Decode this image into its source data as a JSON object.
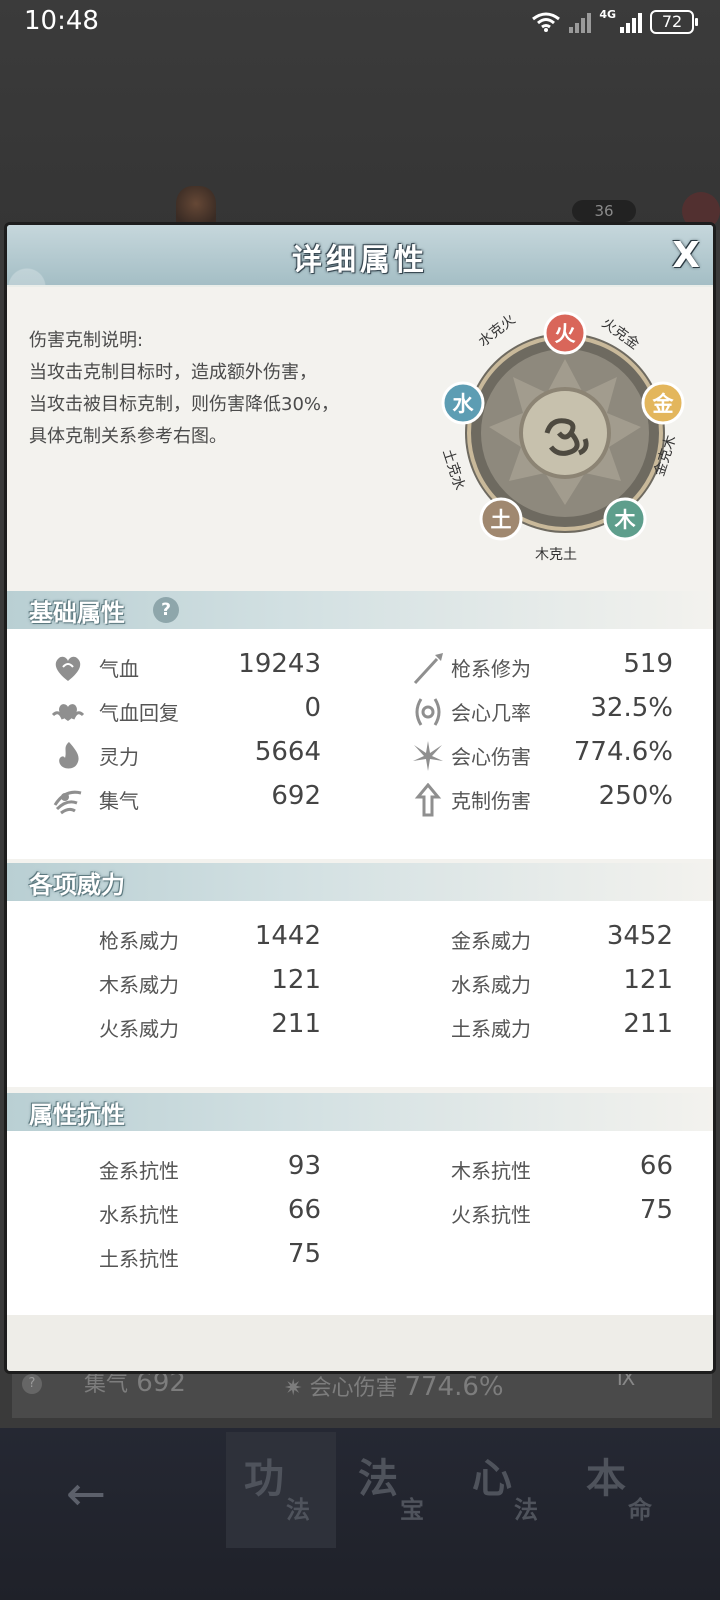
{
  "status_bar": {
    "time": "10:48",
    "battery": "72",
    "network": "4G"
  },
  "background": {
    "badge_count": "36",
    "strip_left_label": "集气",
    "strip_left_value": "692",
    "strip_right_label": "会心伤害",
    "strip_right_value": "774.6%",
    "level_text": "Ⅸ"
  },
  "bottom_nav": {
    "back_icon": "←",
    "tabs": [
      {
        "big": "功",
        "small": "法"
      },
      {
        "big": "法",
        "small": "宝"
      },
      {
        "big": "心",
        "small": "法"
      },
      {
        "big": "本",
        "small": "命"
      }
    ]
  },
  "panel": {
    "title": "详细属性",
    "close": "X",
    "intro": [
      "伤害克制说明:",
      "当攻击克制目标时，造成额外伤害，",
      "当攻击被目标克制，则伤害降低30%，",
      "具体克制关系参考右图。"
    ],
    "wheel": {
      "elements": {
        "fire": "火",
        "metal": "金",
        "wood": "木",
        "earth": "土",
        "water": "水"
      },
      "relations": {
        "fire_metal": "火克金",
        "metal_wood": "金克木",
        "wood_earth": "木克土",
        "earth_water": "土克水",
        "water_fire": "水克火"
      },
      "colors": {
        "fire": "#d9665a",
        "metal": "#e3b65c",
        "wood": "#5e9e8c",
        "earth": "#a08870",
        "water": "#5d9db3"
      }
    },
    "basic": {
      "title": "基础属性",
      "help": "?",
      "left": [
        {
          "icon": "heart-icon",
          "label": "气血",
          "value": "19243"
        },
        {
          "icon": "heart-regen-icon",
          "label": "气血回复",
          "value": "0"
        },
        {
          "icon": "spirit-flame-icon",
          "label": "灵力",
          "value": "5664"
        },
        {
          "icon": "swirl-icon",
          "label": "集气",
          "value": "692"
        }
      ],
      "right": [
        {
          "icon": "spear-icon",
          "label": "枪系修为",
          "value": "519"
        },
        {
          "icon": "crit-rate-icon",
          "label": "会心几率",
          "value": "32.5%"
        },
        {
          "icon": "crit-damage-icon",
          "label": "会心伤害",
          "value": "774.6%"
        },
        {
          "icon": "counter-arrow-icon",
          "label": "克制伤害",
          "value": "250%"
        }
      ]
    },
    "power": {
      "title": "各项威力",
      "left": [
        {
          "label": "枪系威力",
          "value": "1442"
        },
        {
          "label": "木系威力",
          "value": "121"
        },
        {
          "label": "火系威力",
          "value": "211"
        }
      ],
      "right": [
        {
          "label": "金系威力",
          "value": "3452"
        },
        {
          "label": "水系威力",
          "value": "121"
        },
        {
          "label": "土系威力",
          "value": "211"
        }
      ]
    },
    "resist": {
      "title": "属性抗性",
      "left": [
        {
          "label": "金系抗性",
          "value": "93"
        },
        {
          "label": "水系抗性",
          "value": "66"
        },
        {
          "label": "土系抗性",
          "value": "75"
        }
      ],
      "right": [
        {
          "label": "木系抗性",
          "value": "66"
        },
        {
          "label": "火系抗性",
          "value": "75"
        }
      ]
    }
  }
}
